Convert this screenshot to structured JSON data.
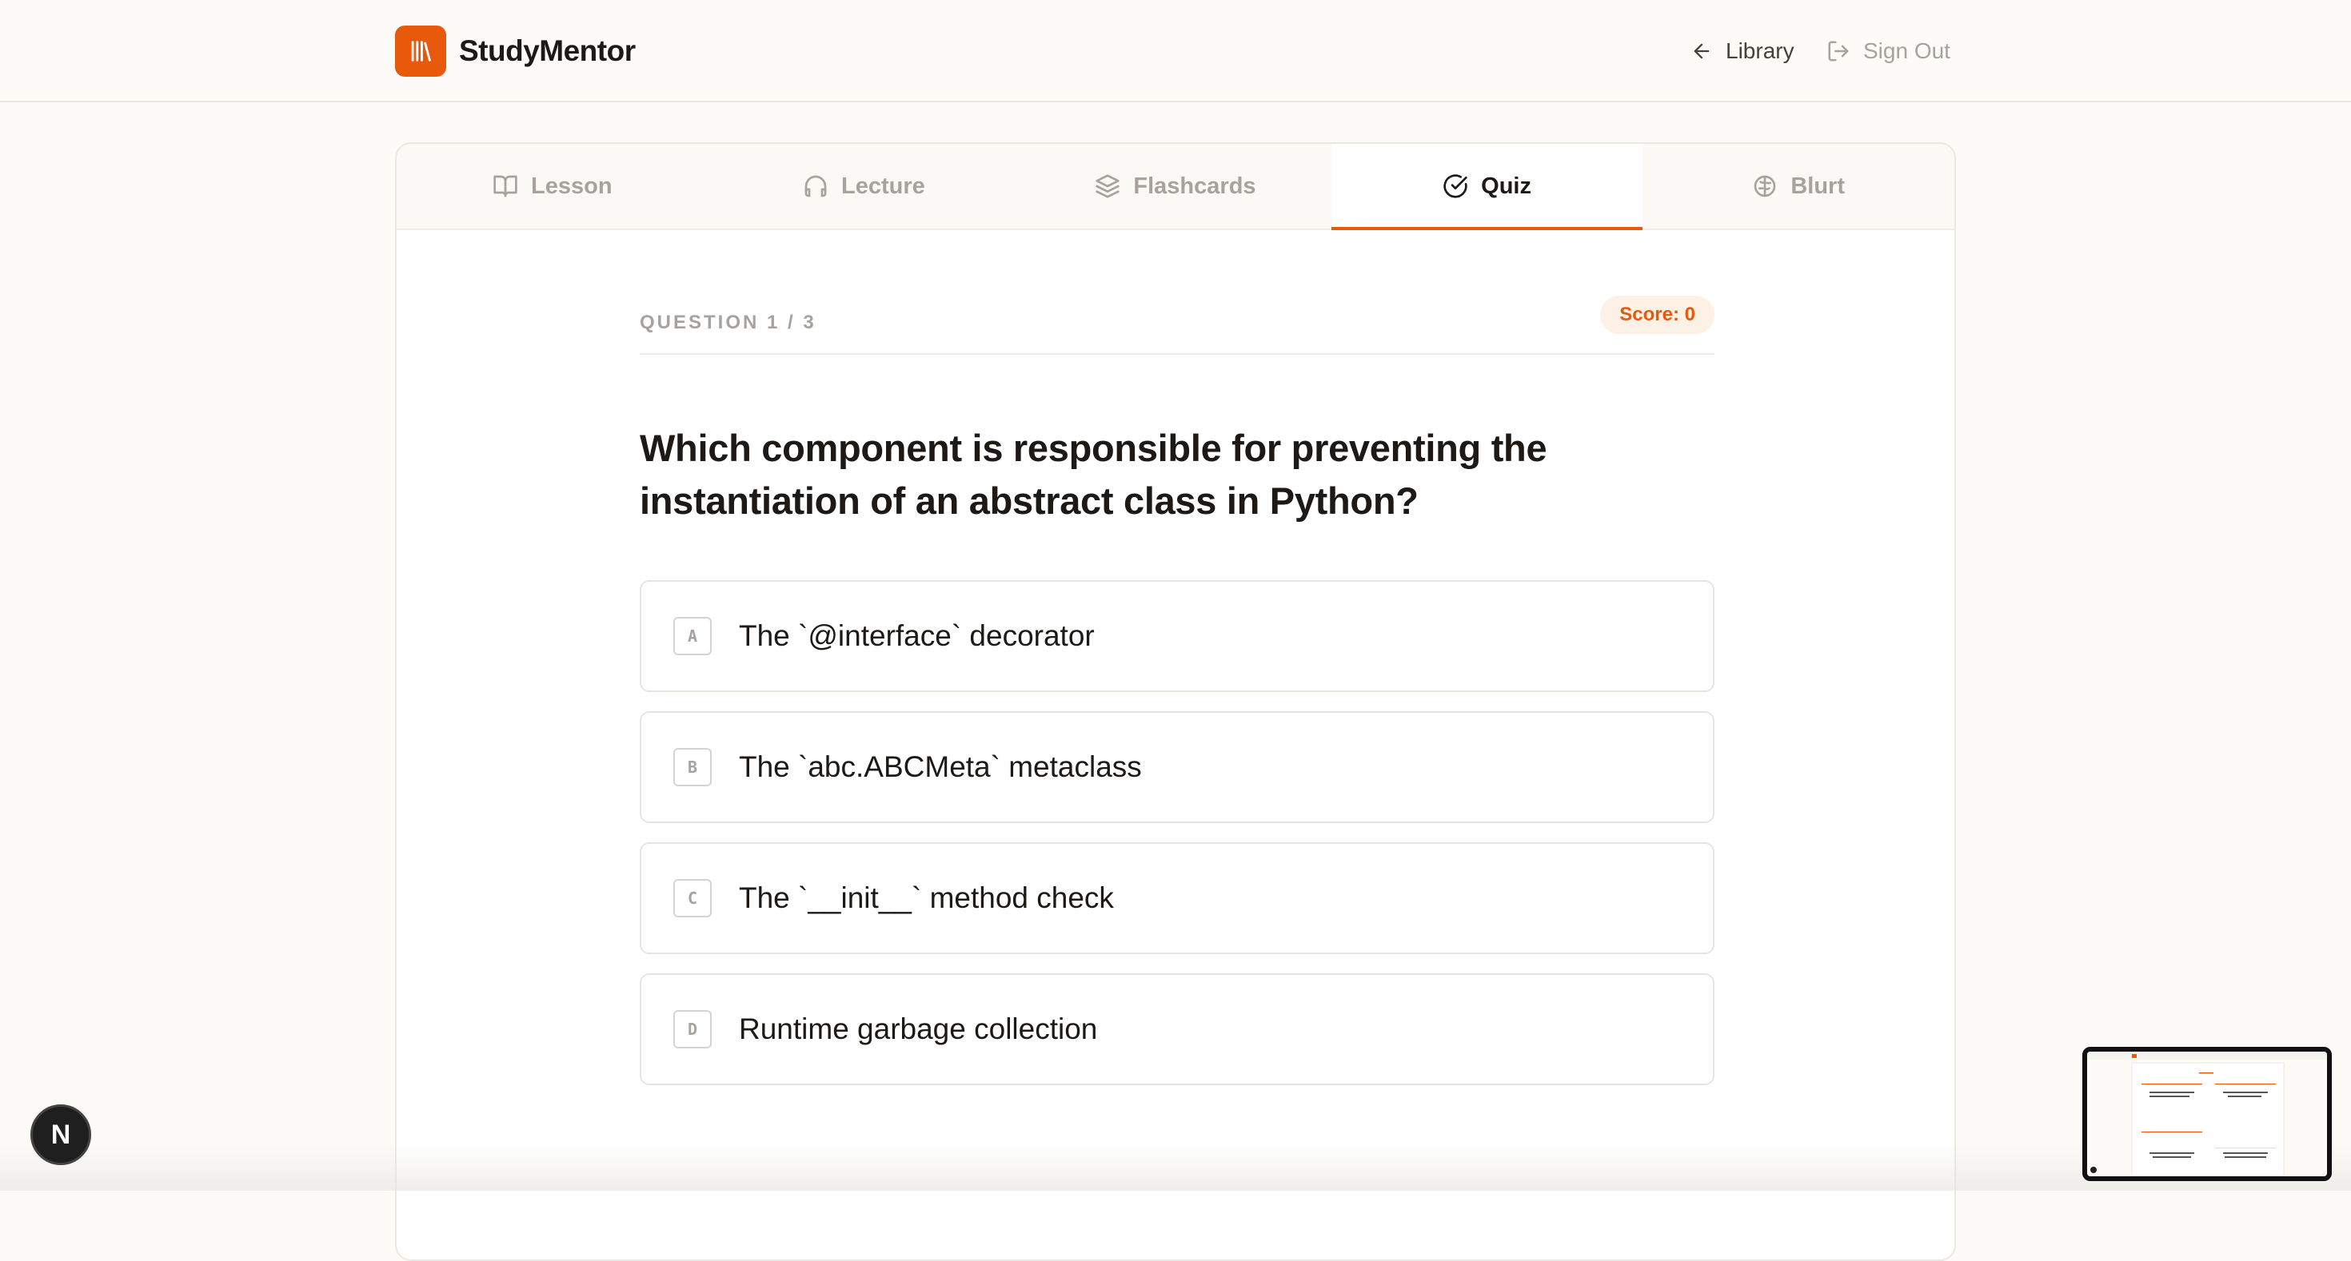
{
  "app": {
    "brand": "StudyMentor"
  },
  "header": {
    "library_label": "Library",
    "signout_label": "Sign Out"
  },
  "tabs": [
    {
      "label": "Lesson",
      "icon": "book-open-icon",
      "active": false
    },
    {
      "label": "Lecture",
      "icon": "headphones-icon",
      "active": false
    },
    {
      "label": "Flashcards",
      "icon": "layers-icon",
      "active": false
    },
    {
      "label": "Quiz",
      "icon": "check-circle-icon",
      "active": true
    },
    {
      "label": "Blurt",
      "icon": "brain-icon",
      "active": false
    }
  ],
  "quiz": {
    "counter": "QUESTION 1 / 3",
    "score": "Score: 0",
    "question": "Which component is responsible for preventing the instantiation of an abstract class in Python?",
    "options": [
      {
        "letter": "A",
        "text": "The `@interface` decorator"
      },
      {
        "letter": "B",
        "text": "The `abc.ABCMeta` metaclass"
      },
      {
        "letter": "C",
        "text": "The `__init__` method check"
      },
      {
        "letter": "D",
        "text": "Runtime garbage collection"
      }
    ]
  },
  "dev_badge": {
    "label": "N"
  },
  "colors": {
    "accent": "#e8590c",
    "score_bg": "#fdf0e4",
    "muted_text": "#a8a29e",
    "page_bg": "#fcfbf8"
  }
}
